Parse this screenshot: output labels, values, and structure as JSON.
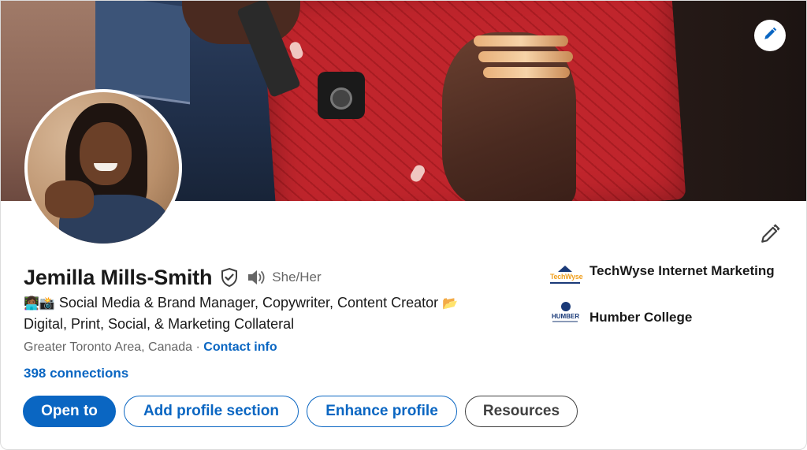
{
  "profile": {
    "name": "Jemilla Mills-Smith",
    "pronouns": "She/Her",
    "headline_prefix_emoji": "👩🏾‍💻📸",
    "headline_main": "Social Media & Brand Manager, Copywriter, Content Creator",
    "headline_folder_emoji": "📂",
    "headline_line2": "Digital, Print, Social, & Marketing Collateral",
    "location": "Greater Toronto Area, Canada",
    "separator": "·",
    "contact_label": "Contact info",
    "connections": "398 connections"
  },
  "buttons": {
    "open_to": "Open to",
    "add_section": "Add profile section",
    "enhance": "Enhance profile",
    "resources": "Resources"
  },
  "organizations": [
    {
      "name": "TechWyse Internet Marketing",
      "logo": "techwyse-logo",
      "logo_text": "TechWyse"
    },
    {
      "name": "Humber College",
      "logo": "humber-logo",
      "logo_text": "HUMBER"
    }
  ],
  "icons": {
    "banner_edit": "pencil-icon",
    "profile_edit": "pencil-icon",
    "verified": "shield-check-icon",
    "pronunciation": "speaker-icon"
  },
  "colors": {
    "accent": "#0a66c2",
    "text_primary": "#191919",
    "text_secondary": "#666666"
  }
}
